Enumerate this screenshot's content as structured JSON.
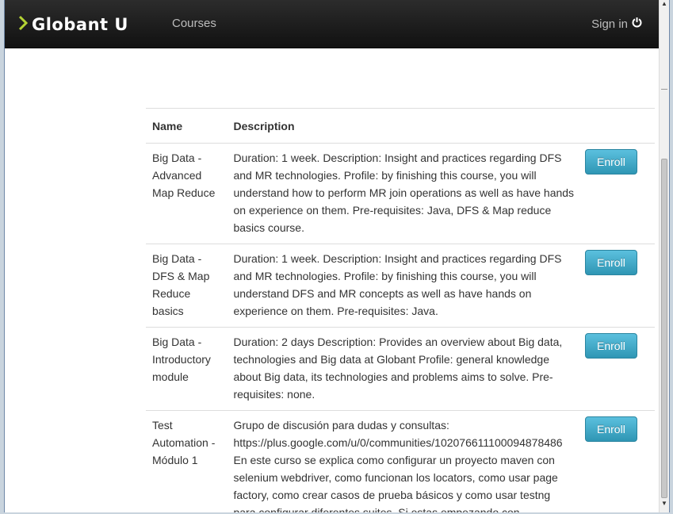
{
  "header": {
    "brand": "Globant U",
    "nav_courses": "Courses",
    "sign_in": "Sign in",
    "colors": {
      "navbar": "#1b1b1b",
      "brand_chevron": "#b4d334",
      "button": "#49afcd"
    }
  },
  "table": {
    "headers": {
      "name": "Name",
      "description": "Description"
    },
    "rows": [
      {
        "name": "Big Data - Advanced Map Reduce",
        "description": "Duration: 1 week. Description: Insight and practices regarding DFS and MR technologies. Profile: by finishing this course, you will understand how to perform MR join operations as well as have hands on experience on them. Pre-requisites: Java, DFS & Map reduce basics course.",
        "action": "Enroll"
      },
      {
        "name": "Big Data - DFS & Map Reduce basics",
        "description": "Duration: 1 week. Description: Insight and practices regarding DFS and MR technologies. Profile: by finishing this course, you will understand DFS and MR concepts as well as have hands on experience on them. Pre-requisites: Java.",
        "action": "Enroll"
      },
      {
        "name": "Big Data - Introductory module",
        "description": "Duration: 2 days Description: Provides an overview about Big data, technologies and Big data at Globant Profile: general knowledge about Big data, its technologies and problems aims to solve. Pre-requisites: none.",
        "action": "Enroll"
      },
      {
        "name": "Test Automation - Módulo 1",
        "description": "Grupo de discusión para dudas y consultas: https://plus.google.com/u/0/communities/102076611100094878486 En este curso se explica como configurar un proyecto maven con selenium webdriver, como funcionan los locators, como usar page factory, como crear casos de prueba básicos y como usar testng para configurar diferentes suites. Si estas empezando con",
        "action": "Enroll"
      }
    ]
  }
}
